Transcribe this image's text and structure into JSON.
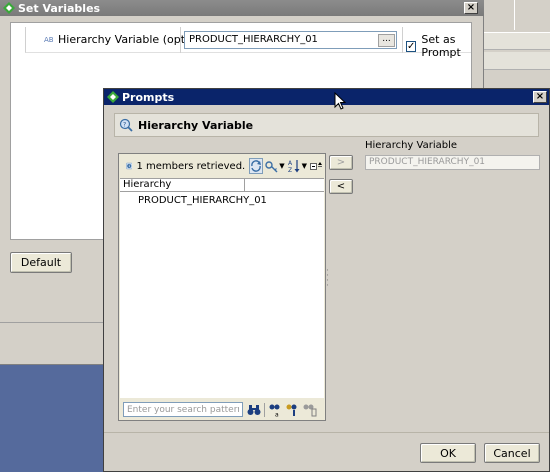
{
  "set_variables": {
    "title": "Set Variables",
    "row": {
      "label": "Hierarchy Variable (optional)",
      "type_marker": "AB",
      "value": "PRODUCT_HIERARCHY_01",
      "browse": "...",
      "set_as_prompt_label": "Set as Prompt",
      "set_as_prompt_checked": true,
      "check_mark": "✓"
    },
    "default_button": "Default",
    "close_glyph": "×"
  },
  "prompts": {
    "title": "Prompts",
    "close_glyph": "×",
    "header_title": "Hierarchy Variable",
    "members_status": "1 members retrieved.",
    "list_header": "Hierarchy",
    "list_items": [
      "PRODUCT_HIERARCHY_01"
    ],
    "search_placeholder": "Enter your search pattern",
    "move_right": ">",
    "move_left": "<",
    "right_label": "Hierarchy Variable",
    "right_value": "PRODUCT_HIERARCHY_01",
    "ok_button": "OK",
    "cancel_button": "Cancel",
    "toolbar_icons": [
      "info-icon",
      "refresh-icon",
      "key-icon",
      "sort-az-icon",
      "collapse-icon"
    ],
    "search_icons": [
      "binoculars-icon",
      "search-keys-icon",
      "search-in-icon",
      "clear-search-icon"
    ]
  },
  "colors": {
    "dialog_titlebar": "#0a246a",
    "inactive_titlebar": "#808080",
    "desktop": "#556a9c",
    "window_bg": "#d4d0c8"
  }
}
